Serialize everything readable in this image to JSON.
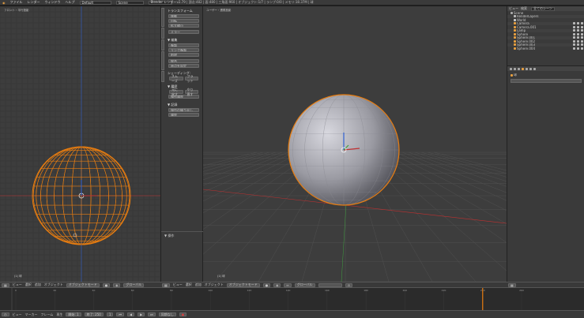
{
  "app": {
    "title": "Blender [C:\\Users\\Desktop\\Blender]",
    "stats": "v2.79 | 頂点:482 | 面:480 | 三角面:960 | オブジェクト:1/7 | ランプ:0/0 | メモリ:18.37M | 球"
  },
  "menu": {
    "file": "ファイル",
    "render": "レンダー",
    "window": "ウィンドウ",
    "help": "ヘルプ"
  },
  "layout_field": "Default",
  "scene_field": "Scene",
  "engine": "Blender レンダー",
  "left_vp": {
    "label": "(1) Sphere",
    "title": "フロント・平行投影",
    "bottom": "(1) 球"
  },
  "main_vp": {
    "title": "ユーザー・透視投影",
    "bottom": "(1) 球"
  },
  "toolshelf": {
    "tab_labels": [
      "ツール",
      "作成",
      "関係",
      "アニメーション",
      "物理演算",
      "グリースペンシル"
    ],
    "s1_title": "トランスフォーム",
    "s1": [
      "移動",
      "回転",
      "拡大縮小"
    ],
    "s1b": [
      "ミラー"
    ],
    "s2_title": "▼ 編集",
    "s2": [
      "複製",
      "リンク複製",
      "削除"
    ],
    "s3": [
      "統合",
      "原点を設定"
    ],
    "s4_title": "シェーディング:",
    "s4": [
      "スムーズ",
      "フラット"
    ],
    "s5_title": "▼ 履歴",
    "s5": [
      "元に戻す",
      "やり直す",
      "操作履歴"
    ],
    "s6_title": "▼ 記録",
    "s6": [
      "操作の繰り返し",
      "履歴"
    ],
    "op_title": "▼ 操作"
  },
  "outliner": {
    "view": "ビュー",
    "search": "検索",
    "all_scenes": "全てのシーン",
    "items": [
      {
        "name": "Scene",
        "indent": 0,
        "icon": "#aaa"
      },
      {
        "name": "RenderLayers",
        "indent": 1,
        "icon": "#bbb"
      },
      {
        "name": "World",
        "indent": 1,
        "icon": "#ccc"
      },
      {
        "name": "Camera",
        "indent": 1,
        "icon": "#e8a040"
      },
      {
        "name": "Camera.001",
        "indent": 1,
        "icon": "#e8a040"
      },
      {
        "name": "Lamp",
        "indent": 1,
        "icon": "#e8a040"
      },
      {
        "name": "Sphere",
        "indent": 1,
        "icon": "#e8a040"
      },
      {
        "name": "Sphere.001",
        "indent": 1,
        "icon": "#e8a040"
      },
      {
        "name": "Sphere.002",
        "indent": 1,
        "icon": "#e8a040"
      },
      {
        "name": "Sphere.003",
        "indent": 1,
        "icon": "#e8a040"
      },
      {
        "name": "Sphere.004",
        "indent": 1,
        "icon": "#e8a040"
      }
    ]
  },
  "props": {
    "name_field": "球"
  },
  "left_bar": {
    "view": "ビュー",
    "select": "選択",
    "add": "追加",
    "object": "オブジェクト",
    "mode": "オブジェクトモード",
    "global": "グローバル"
  },
  "main_bar": {
    "view": "ビュー",
    "select": "選択",
    "add": "追加",
    "object": "オブジェクト",
    "mode": "オブジェクトモード",
    "global": "グローバル"
  },
  "timeline_bar": {
    "view": "ビュー",
    "marker": "マーカー",
    "frame": "フレーム",
    "playback": "再生",
    "start": "開始: 1",
    "end": "終了: 250",
    "current": "1",
    "nosync": "同期なし"
  },
  "timeline": {
    "ticks": [
      "0",
      "20",
      "40",
      "60",
      "80",
      "100",
      "120",
      "140",
      "160",
      "180",
      "200",
      "220",
      "240",
      "260"
    ],
    "cursor_frame": 240
  },
  "colors": {
    "accent": "#e8a040",
    "select": "#e87d10",
    "xaxis": "#c03030",
    "yaxis": "#40a040",
    "zaxis": "#3060d0"
  }
}
